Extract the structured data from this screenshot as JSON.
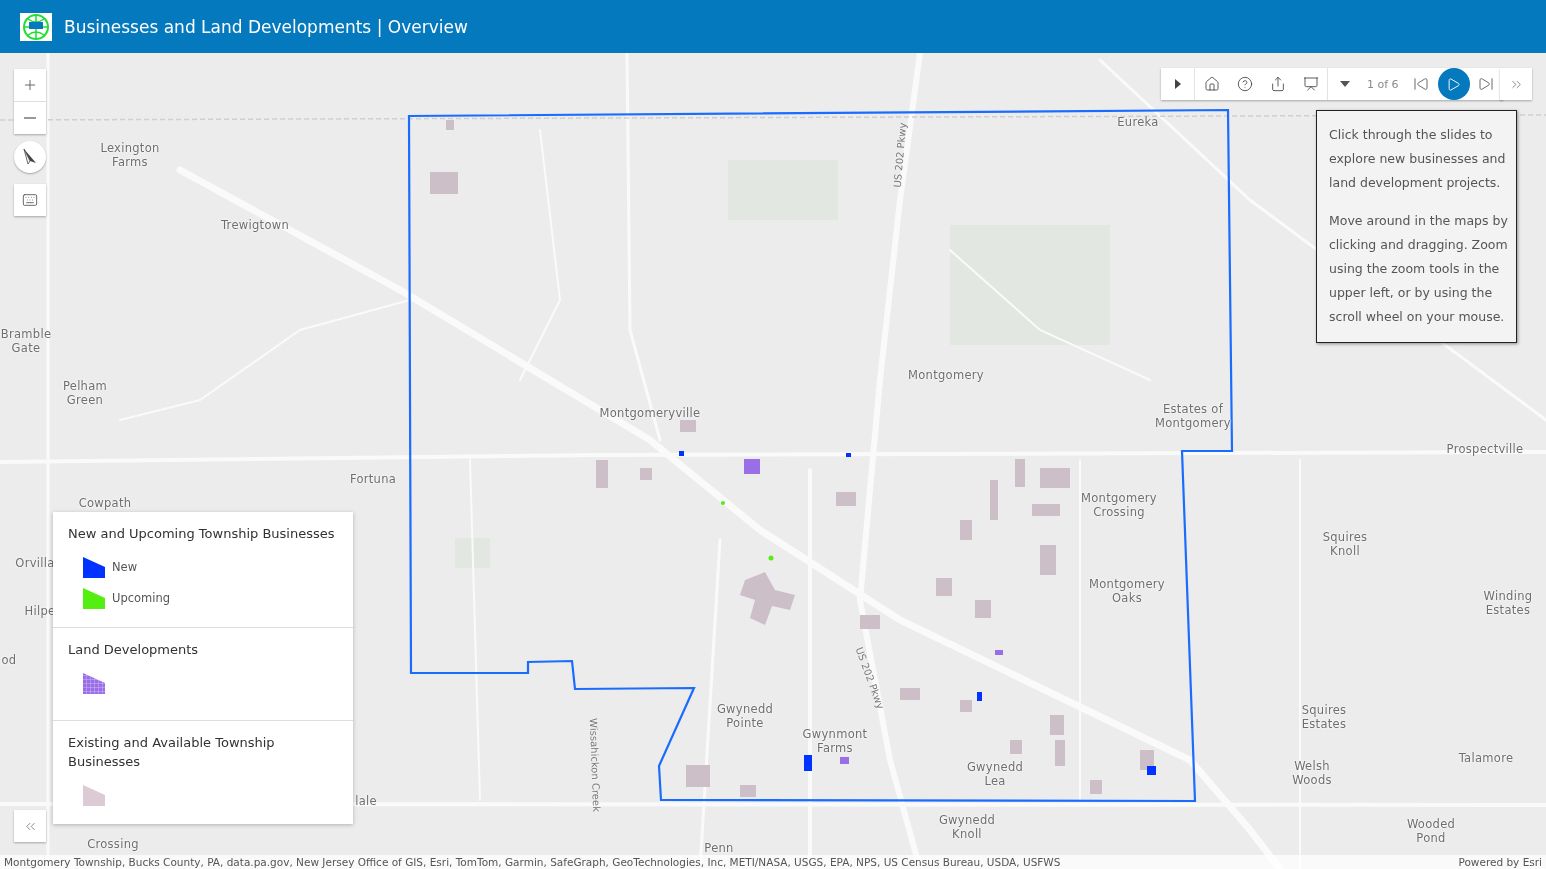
{
  "header": {
    "title": "Businesses and Land Developments | Overview"
  },
  "map": {
    "place_labels": [
      {
        "lines": [
          "Lexington",
          "Farms"
        ]
      },
      {
        "lines": [
          "Trewigtown"
        ]
      },
      {
        "lines": [
          "Bramble",
          "Gate"
        ]
      },
      {
        "lines": [
          "Pelham",
          "Green"
        ]
      },
      {
        "lines": [
          "Cowpath"
        ]
      },
      {
        "lines": [
          "Orvilla"
        ]
      },
      {
        "lines": [
          "Hilpe"
        ]
      },
      {
        "lines": [
          "od"
        ]
      },
      {
        "lines": [
          "Fortuna"
        ]
      },
      {
        "lines": [
          "lale"
        ]
      },
      {
        "lines": [
          "Crossing"
        ]
      },
      {
        "lines": [
          "Eureka"
        ]
      },
      {
        "lines": [
          "Montgomery"
        ]
      },
      {
        "lines": [
          "Estates of",
          "Montgomery"
        ]
      },
      {
        "lines": [
          "Prospectville"
        ]
      },
      {
        "lines": [
          "Montgomeryville"
        ]
      },
      {
        "lines": [
          "Montgomery",
          "Crossing"
        ]
      },
      {
        "lines": [
          "Squires",
          "Knoll"
        ]
      },
      {
        "lines": [
          "Montgomery",
          "Oaks"
        ]
      },
      {
        "lines": [
          "Winding",
          "Estates"
        ]
      },
      {
        "lines": [
          "Gwynedd",
          "Pointe"
        ]
      },
      {
        "lines": [
          "Gwynmont",
          "Farms"
        ]
      },
      {
        "lines": [
          "Gwynedd",
          "Lea"
        ]
      },
      {
        "lines": [
          "Squires",
          "Estates"
        ]
      },
      {
        "lines": [
          "Welsh",
          "Woods"
        ]
      },
      {
        "lines": [
          "Talamore"
        ]
      },
      {
        "lines": [
          "Gwynedd",
          "Knoll"
        ]
      },
      {
        "lines": [
          "Penn"
        ]
      },
      {
        "lines": [
          "Wooded",
          "Pond"
        ]
      }
    ],
    "road_labels": [
      "US 202 Pkwy",
      "US 202 Pkwy",
      "Wissahickon Creek"
    ]
  },
  "slides": {
    "counter": "1 of 6",
    "playing": false
  },
  "info_panel": {
    "paragraphs": [
      "Click through the slides to explore new businesses and land development projects.",
      "Move around in the maps by clicking and dragging. Zoom using the zoom tools in the upper left, or by using the scroll wheel on your mouse."
    ]
  },
  "legend": {
    "sections": [
      {
        "title": "New and Upcoming Township Businesses",
        "items": [
          {
            "kind": "solid",
            "label": "New",
            "color": "#0033ff"
          },
          {
            "kind": "solid",
            "label": "Upcoming",
            "color": "#55ee11"
          }
        ]
      },
      {
        "title": "Land Developments",
        "items": [
          {
            "kind": "hatched",
            "color": "#9a6ee6"
          }
        ]
      },
      {
        "title": "Existing and Available Township Businesses",
        "items": [
          {
            "kind": "solid",
            "color": "#dccbd4"
          }
        ]
      }
    ]
  },
  "attribution": {
    "sources": "Montgomery Township, Bucks County, PA, data.pa.gov, New Jersey Office of GIS, Esri, TomTom, Garmin, SafeGraph, GeoTechnologies, Inc, METI/NASA, USGS, EPA, NPS, US Census Bureau, USDA, USFWS",
    "powered_by": "Powered by Esri"
  }
}
